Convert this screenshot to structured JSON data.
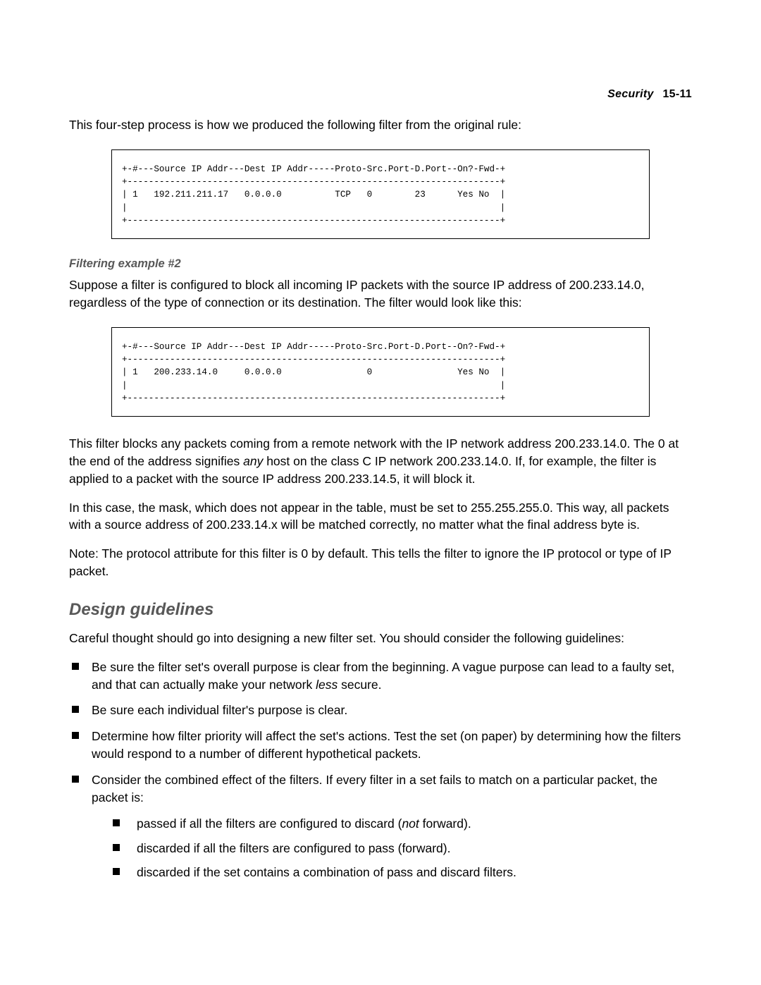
{
  "header": {
    "section": "Security",
    "page": "15-11"
  },
  "intro_para": "This four-step process is how we produced the following filter from the original rule:",
  "code1": "+-#---Source IP Addr---Dest IP Addr-----Proto-Src.Port-D.Port--On?-Fwd-+\n+----------------------------------------------------------------------+\n| 1   192.211.211.17   0.0.0.0          TCP   0        23      Yes No  |\n|                                                                      |\n+----------------------------------------------------------------------+",
  "subheading1": "Filtering example #2",
  "para2": "Suppose a filter is configured to block all incoming IP packets with the source IP address of 200.233.14.0, regardless of the type of connection or its destination. The filter would look like this:",
  "code2": "+-#---Source IP Addr---Dest IP Addr-----Proto-Src.Port-D.Port--On?-Fwd-+\n+----------------------------------------------------------------------+\n| 1   200.233.14.0     0.0.0.0                0                Yes No  |\n|                                                                      |\n+----------------------------------------------------------------------+",
  "para3_a": "This filter blocks any packets coming from a remote network with the IP network address 200.233.14.0. The 0 at the end of the address signifies ",
  "para3_b": "any",
  "para3_c": " host on the class C IP network 200.233.14.0. If, for example, the filter is applied to a packet with the source IP address 200.233.14.5, it will block it.",
  "para4": "In this case, the mask, which does not appear in the table, must be set to 255.255.255.0. This way, all packets with a source address of 200.233.14.x will be matched correctly, no matter what the final address byte is.",
  "para5": "Note: The protocol attribute for this filter is 0 by default. This tells the filter to ignore the IP protocol or type of IP packet.",
  "section_heading": "Design guidelines",
  "para6": "Careful thought should go into designing a new filter set. You should consider the following guidelines:",
  "bullets": {
    "b1_a": "Be sure the filter set's overall purpose is clear from the beginning. A vague purpose can lead to a faulty set, and that can actually make your network ",
    "b1_b": "less",
    "b1_c": " secure.",
    "b2": "Be sure each individual filter's purpose is clear.",
    "b3": "Determine how filter priority will affect the set's actions. Test the set (on paper) by determining how the filters would respond to a number of different hypothetical packets.",
    "b4": "Consider the combined effect of the filters. If every filter in a set fails to match on a particular packet, the packet is:",
    "sub": {
      "s1_a": "passed if all the filters are configured to discard (",
      "s1_b": "not",
      "s1_c": " forward).",
      "s2": "discarded if all the filters are configured to pass (forward).",
      "s3": "discarded if the set contains a combination of pass and discard filters."
    }
  }
}
